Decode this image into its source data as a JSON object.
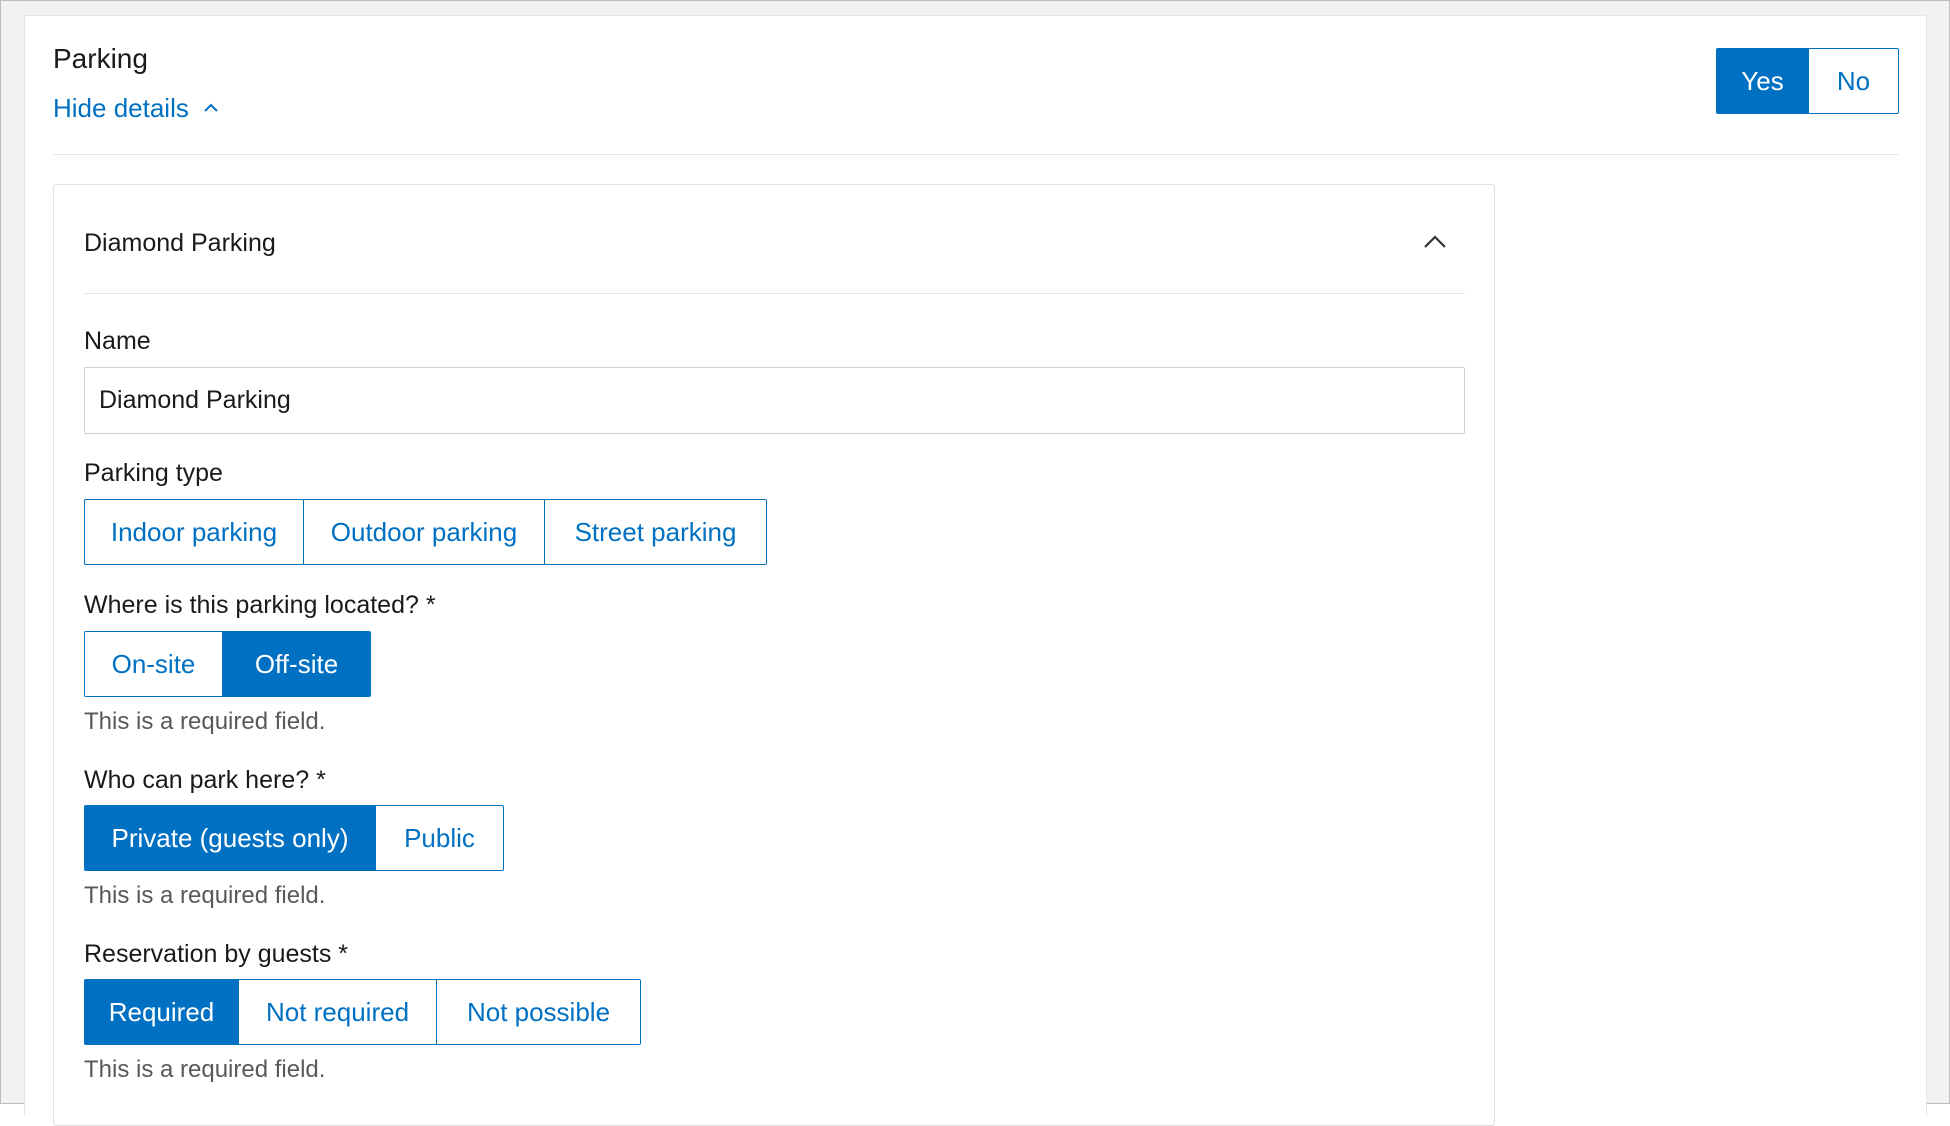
{
  "section": {
    "title": "Parking",
    "toggle_details": "Hide details",
    "answer": {
      "options": [
        "Yes",
        "No"
      ],
      "selected": "Yes"
    }
  },
  "panel": {
    "title": "Diamond Parking",
    "name_label": "Name",
    "name_value": "Diamond Parking",
    "parking_type": {
      "label": "Parking type",
      "options": [
        "Indoor parking",
        "Outdoor parking",
        "Street parking"
      ],
      "selected": null
    },
    "location": {
      "label": "Where is this parking located? *",
      "options": [
        "On-site",
        "Off-site"
      ],
      "selected": "Off-site",
      "help": "This is a required field."
    },
    "who_can_park": {
      "label": "Who can park here? *",
      "options": [
        "Private (guests only)",
        "Public"
      ],
      "selected": "Private (guests only)",
      "help": "This is a required field."
    },
    "reservation": {
      "label": "Reservation by guests *",
      "options": [
        "Required",
        "Not required",
        "Not possible"
      ],
      "selected": "Required",
      "help": "This is a required field."
    }
  },
  "colors": {
    "accent": "#0071c2",
    "border": "#e6e6e6",
    "help_text": "#595959"
  },
  "icons": {
    "details_toggle": "chevron-up-icon",
    "panel_collapse": "chevron-up-icon"
  }
}
